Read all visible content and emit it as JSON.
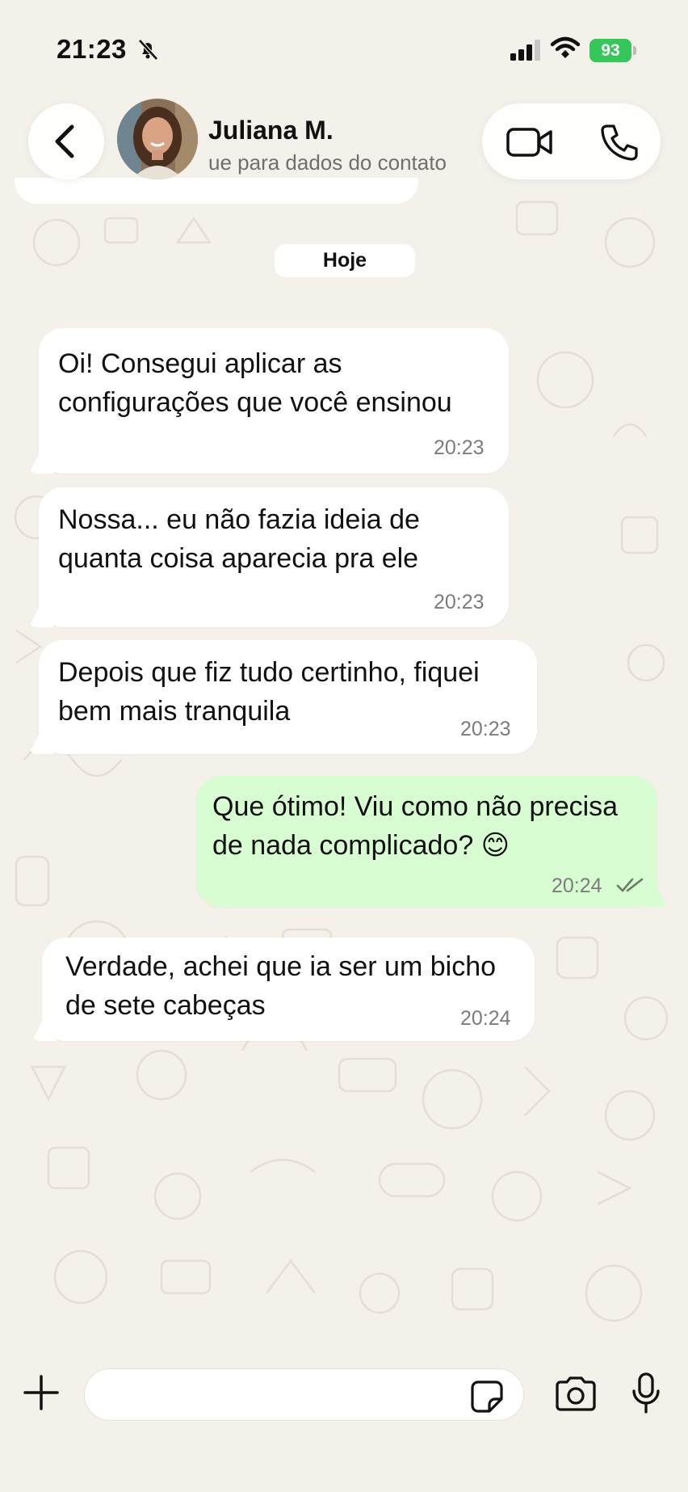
{
  "status_bar": {
    "time": "21:23",
    "battery": "93"
  },
  "header": {
    "contact_name": "Juliana M.",
    "contact_subtitle": "ue para dados do contato"
  },
  "day_separator": "Hoje",
  "messages": [
    {
      "direction": "incoming",
      "line1": "Oi! Consegui aplicar as",
      "line2": "configurações que você ensinou",
      "time": "20:23"
    },
    {
      "direction": "incoming",
      "line1": "Nossa... eu não fazia ideia de",
      "line2": "quanta coisa aparecia pra ele",
      "time": "20:23"
    },
    {
      "direction": "incoming",
      "line1": "Depois que fiz tudo certinho, fiquei",
      "line2": "bem mais tranquila",
      "time": "20:23"
    },
    {
      "direction": "outgoing",
      "line1": "Que ótimo! Viu como não precisa",
      "line2": "de nada complicado? 😊",
      "time": "20:24",
      "status": "read"
    },
    {
      "direction": "incoming",
      "line1": "Verdade, achei que ia ser um bicho",
      "line2": "de sete cabeças",
      "time": "20:24"
    }
  ],
  "composer": {
    "placeholder": ""
  },
  "icons": {
    "back": "chevron-left-icon",
    "video": "video-camera-icon",
    "phone": "phone-icon",
    "plus": "plus-icon",
    "sticker": "sticker-icon",
    "camera": "camera-icon",
    "mic": "microphone-icon",
    "muted": "bell-slash-icon"
  },
  "colors": {
    "background": "#f4f0ea",
    "incoming_bubble": "#ffffff",
    "outgoing_bubble": "#d8fdd2",
    "battery": "#35c759",
    "read_ticks": "#6b7a66"
  }
}
